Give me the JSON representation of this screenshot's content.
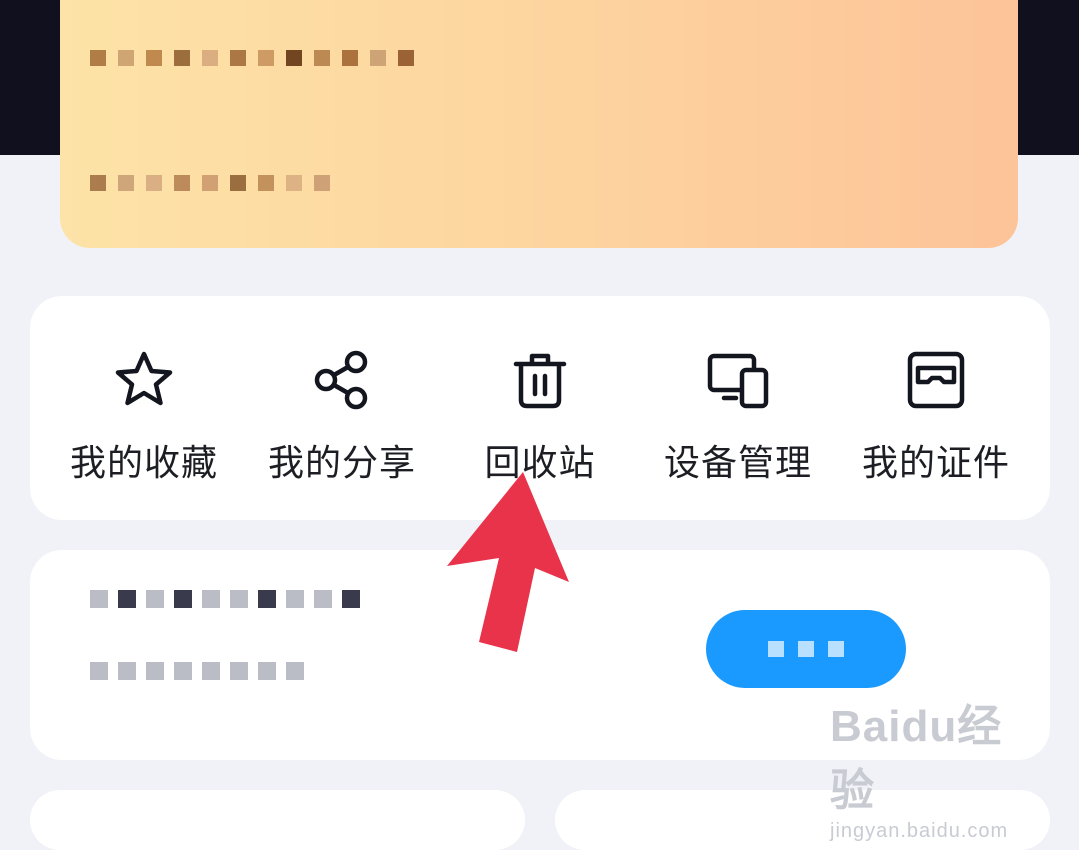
{
  "tools": [
    {
      "label": "我的收藏",
      "icon": "star-icon"
    },
    {
      "label": "我的分享",
      "icon": "share-icon"
    },
    {
      "label": "回收站",
      "icon": "trash-icon"
    },
    {
      "label": "设备管理",
      "icon": "devices-icon"
    },
    {
      "label": "我的证件",
      "icon": "id-card-icon"
    }
  ],
  "colors": {
    "accent": "#1a9aff",
    "highlight_arrow": "#e8334a",
    "vip_gradient_start": "#fde3a7",
    "vip_gradient_end": "#fdc399"
  },
  "watermark": {
    "logo": "Baidu经验",
    "url": "jingyan.baidu.com"
  }
}
